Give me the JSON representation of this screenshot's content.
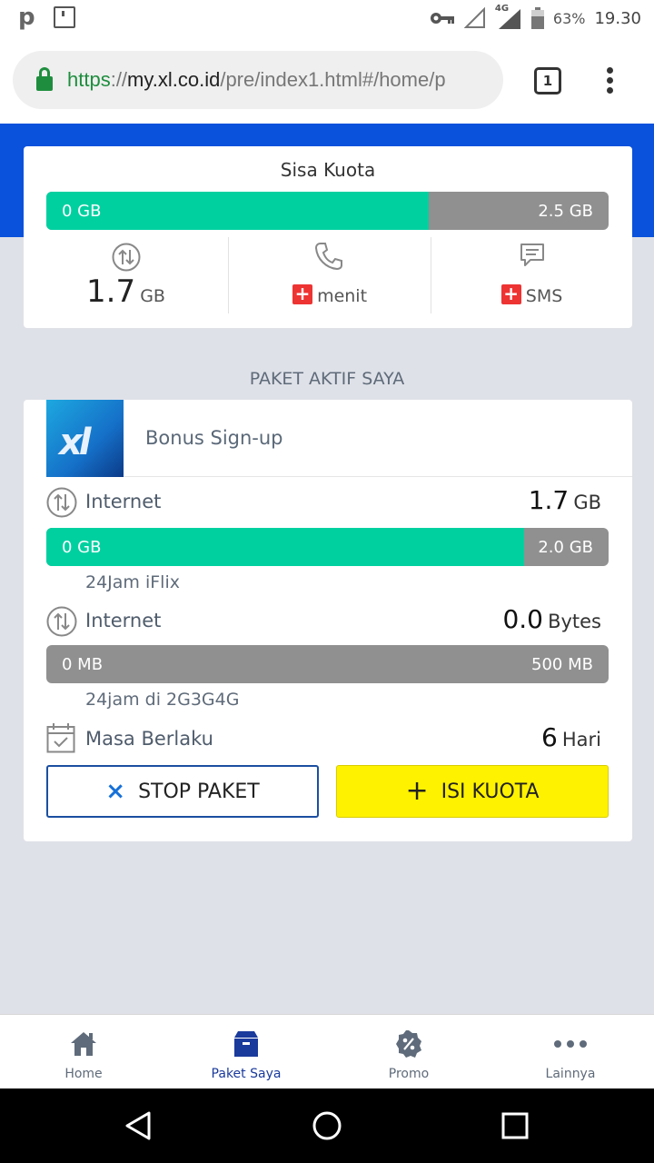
{
  "status_bar": {
    "left_icons": [
      "p-icon",
      "notification-box-icon"
    ],
    "network": "4G",
    "battery": "63%",
    "time": "19.30"
  },
  "browser": {
    "url_proto": "https",
    "url_sep": "://",
    "url_host": "my.xl.co.id",
    "url_path": "/pre/index1.html#/home/p",
    "tab_count": "1"
  },
  "quota": {
    "title": "Sisa Kuota",
    "bar_left": "0 GB",
    "bar_right": "2.5 GB",
    "bar_fill_fraction": 0.68,
    "data_value": "1.7",
    "data_unit": "GB",
    "voice_label": "menit",
    "sms_label": "SMS",
    "plus": "+"
  },
  "section_title": "PAKET AKTIF SAYA",
  "package": {
    "name": "Bonus Sign-up",
    "logo_text": "xl",
    "items": [
      {
        "label": "Internet",
        "value": "1.7",
        "unit": "GB",
        "bar_left": "0 GB",
        "bar_right": "2.0 GB",
        "bar_fill_fraction": 0.85,
        "sub_label": "24Jam iFlix"
      },
      {
        "label": "Internet",
        "value": "0.0",
        "unit": "Bytes",
        "bar_left": "0 MB",
        "bar_right": "500 MB",
        "bar_fill_fraction": 0,
        "sub_label": "24jam di 2G3G4G"
      }
    ],
    "validity_label": "Masa Berlaku",
    "validity_value": "6",
    "validity_unit": "Hari",
    "stop_button": "STOP PAKET",
    "stop_icon": "×",
    "topup_button": "ISI KUOTA",
    "topup_icon": "+"
  },
  "bottom_nav": {
    "items": [
      {
        "label": "Home",
        "icon": "home-icon"
      },
      {
        "label": "Paket Saya",
        "icon": "package-box-icon",
        "active": true
      },
      {
        "label": "Promo",
        "icon": "promo-percent-icon"
      },
      {
        "label": "Lainnya",
        "icon": "more-dots-icon"
      }
    ]
  },
  "colors": {
    "brand_blue": "#0a51dc",
    "bar_green": "#00d0a0",
    "bar_gray": "#909090",
    "topup_yellow": "#fff200",
    "nav_active": "#1a3a9c"
  }
}
